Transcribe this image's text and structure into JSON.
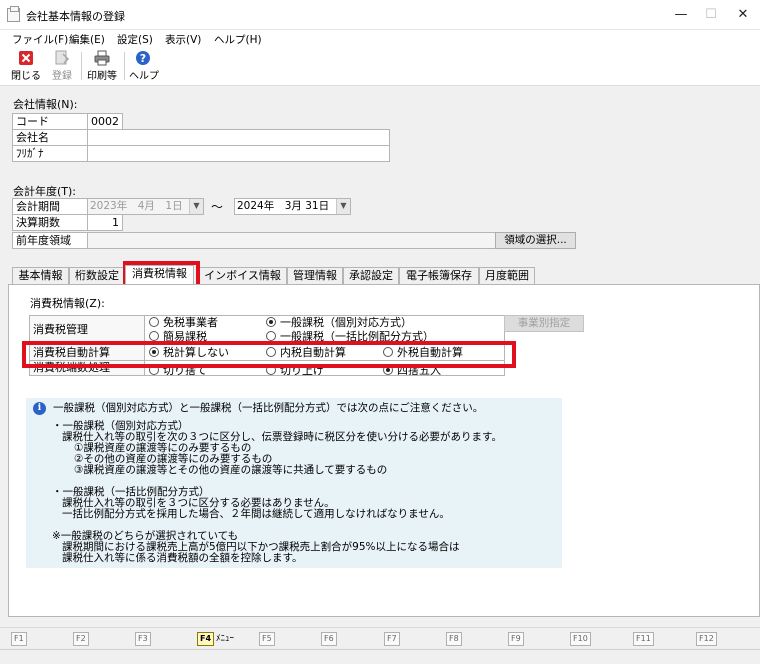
{
  "window": {
    "title": "会社基本情報の登録",
    "minimize": "—",
    "maximize": "☐",
    "close": "✕"
  },
  "menubar": [
    "ファイル(F)",
    "編集(E)",
    "設定(S)",
    "表示(V)",
    "ヘルプ(H)"
  ],
  "toolbar": {
    "close_label": "閉じる",
    "register_label": "登録",
    "print_label": "印刷等",
    "help_label": "ヘルプ",
    "close_icon_color": "#d9262b",
    "help_icon_color": "#2a62c9"
  },
  "company": {
    "section_title": "会社情報(N):",
    "code_label": "コード",
    "code_value": "0002",
    "name_label": "会社名",
    "name_value": "",
    "kana_label": "ﾌﾘｶﾞﾅ",
    "kana_value": ""
  },
  "fiscal": {
    "section_title": "会計年度(T):",
    "period_label": "会計期間",
    "start_date": "2023年　4月　1日",
    "range_sep": "～",
    "end_date": "2024年　3月 31日",
    "term_label": "決算期数",
    "term_value": "1",
    "prev_label": "前年度領域",
    "prev_value": "",
    "select_area_button": "領域の選択..."
  },
  "tabs": [
    {
      "label": "基本情報"
    },
    {
      "label": "桁数設定"
    },
    {
      "label": "消費税情報"
    },
    {
      "label": "インボイス情報"
    },
    {
      "label": "管理情報"
    },
    {
      "label": "承認設定"
    },
    {
      "label": "電子帳簿保存"
    },
    {
      "label": "月度範囲"
    }
  ],
  "tax": {
    "section_title": "消費税情報(Z):",
    "mgmt_label": "消費税管理",
    "mgmt_options": [
      "免税事業者",
      "一般課税（個別対応方式）",
      "簡易課税",
      "一般課税（一括比例配分方式）"
    ],
    "per_business_button": "事業別指定",
    "auto_label": "消費税自動計算",
    "auto_options": [
      "税計算しない",
      "内税自動計算",
      "外税自動計算"
    ],
    "rounding_label": "消費税端数処理",
    "rounding_options": [
      "切り捨て",
      "切り上げ",
      "四捨五入"
    ],
    "highlight_color": "#e0101d"
  },
  "info": {
    "icon": "i",
    "lines": [
      "一般課税（個別対応方式）と一般課税（一括比例配分方式）では次の点にご注意ください。",
      "・一般課税（個別対応方式）",
      "課税仕入れ等の取引を次の３つに区分し、伝票登録時に税区分を使い分ける必要があります。",
      "①課税資産の譲渡等にのみ要するもの",
      "②その他の資産の譲渡等にのみ要するもの",
      "③課税資産の譲渡等とその他の資産の譲渡等に共通して要するもの",
      "・一般課税（一括比例配分方式）",
      "課税仕入れ等の取引を３つに区分する必要はありません。",
      "一括比例配分方式を採用した場合、２年間は継続して適用しなければなりません。",
      "※一般課税のどちらが選択されていても",
      "課税期間における課税売上高が5億円以下かつ課税売上割合が95%以上になる場合は",
      "課税仕入れ等に係る消費税額の全額を控除します。"
    ]
  },
  "fkeys": [
    {
      "key": "F1",
      "label": ""
    },
    {
      "key": "F2",
      "label": ""
    },
    {
      "key": "F3",
      "label": ""
    },
    {
      "key": "F4",
      "label": "ﾒﾆｭｰ"
    },
    {
      "key": "F5",
      "label": ""
    },
    {
      "key": "F6",
      "label": ""
    },
    {
      "key": "F7",
      "label": ""
    },
    {
      "key": "F8",
      "label": ""
    },
    {
      "key": "F9",
      "label": ""
    },
    {
      "key": "F10",
      "label": ""
    },
    {
      "key": "F11",
      "label": ""
    },
    {
      "key": "F12",
      "label": ""
    }
  ]
}
